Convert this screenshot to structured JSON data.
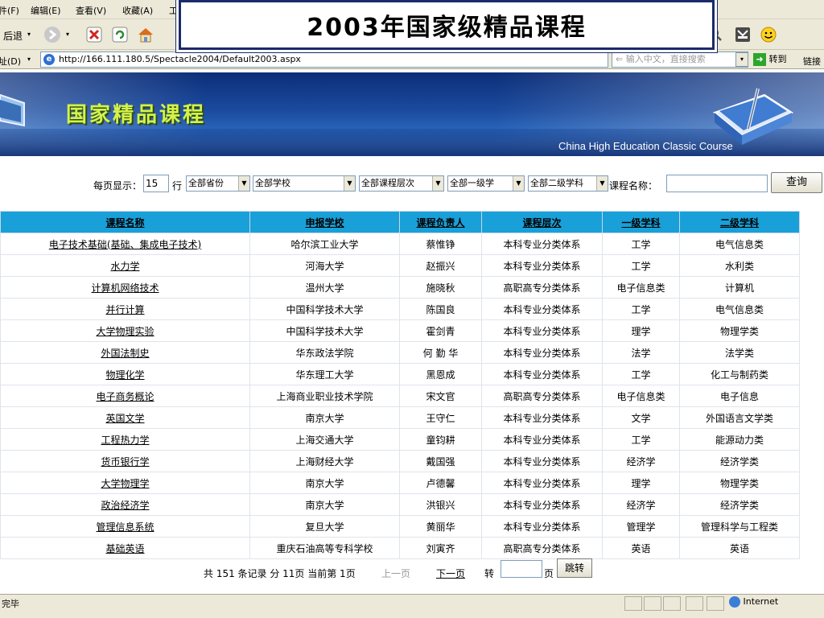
{
  "slide_title": "2003年国家级精品课程",
  "menu": [
    "件(F)",
    "编辑(E)",
    "查看(V)",
    "收藏(A)",
    "工"
  ],
  "toolbar": {
    "back": "后退",
    "goto": "转到",
    "links": "链接"
  },
  "address": {
    "label": "址(D)",
    "url": "http://166.111.180.5/Spectacle2004/Default2003.aspx"
  },
  "search_placeholder": "输入中文，直接搜索",
  "banner": {
    "logo_text": "国家精品课程",
    "english": "China High Education Classic Course"
  },
  "filters": {
    "per_page_label": "每页显示：",
    "per_page_value": "15",
    "per_page_unit": "行",
    "province": "全部省份",
    "school": "全部学校",
    "level": "全部课程层次",
    "subject1": "全部一级学",
    "subject2": "全部二级学科",
    "course_name_label": "课程名称：",
    "query_button": "查询"
  },
  "table": {
    "headers": [
      "课程名称",
      "申报学校",
      "课程负责人",
      "课程层次",
      "一级学科",
      "二级学科"
    ],
    "rows": [
      [
        "电子技术基础(基础、集成电子技术)",
        "哈尔滨工业大学",
        "蔡惟铮",
        "本科专业分类体系",
        "工学",
        "电气信息类"
      ],
      [
        "水力学",
        "河海大学",
        "赵振兴",
        "本科专业分类体系",
        "工学",
        "水利类"
      ],
      [
        "计算机网络技术",
        "温州大学",
        "施晓秋",
        "高职高专分类体系",
        "电子信息类",
        "计算机"
      ],
      [
        "并行计算",
        "中国科学技术大学",
        "陈国良",
        "本科专业分类体系",
        "工学",
        "电气信息类"
      ],
      [
        "大学物理实验",
        "中国科学技术大学",
        "霍剑青",
        "本科专业分类体系",
        "理学",
        "物理学类"
      ],
      [
        "外国法制史",
        "华东政法学院",
        "何 勤 华",
        "本科专业分类体系",
        "法学",
        "法学类"
      ],
      [
        "物理化学",
        "华东理工大学",
        "黑恩成",
        "本科专业分类体系",
        "工学",
        "化工与制药类"
      ],
      [
        "电子商务概论",
        "上海商业职业技术学院",
        "宋文官",
        "高职高专分类体系",
        "电子信息类",
        "电子信息"
      ],
      [
        "英国文学",
        "南京大学",
        "王守仁",
        "本科专业分类体系",
        "文学",
        "外国语言文学类"
      ],
      [
        "工程热力学",
        "上海交通大学",
        "童钧耕",
        "本科专业分类体系",
        "工学",
        "能源动力类"
      ],
      [
        "货币银行学",
        "上海财经大学",
        "戴国强",
        "本科专业分类体系",
        "经济学",
        "经济学类"
      ],
      [
        "大学物理学",
        "南京大学",
        "卢德馨",
        "本科专业分类体系",
        "理学",
        "物理学类"
      ],
      [
        "政治经济学",
        "南京大学",
        "洪银兴",
        "本科专业分类体系",
        "经济学",
        "经济学类"
      ],
      [
        "管理信息系统",
        "复旦大学",
        "黄丽华",
        "本科专业分类体系",
        "管理学",
        "管理科学与工程类"
      ],
      [
        "基础英语",
        "重庆石油高等专科学校",
        "刘寅齐",
        "高职高专分类体系",
        "英语",
        "英语"
      ]
    ]
  },
  "pager": {
    "summary": "共 151 条记录 分 11页 当前第 1页",
    "prev": "上一页",
    "next": "下一页",
    "goto_label": "转",
    "page_unit": "页",
    "jump_button": "跳转"
  },
  "status": {
    "text": "完毕",
    "zone": "Internet"
  }
}
